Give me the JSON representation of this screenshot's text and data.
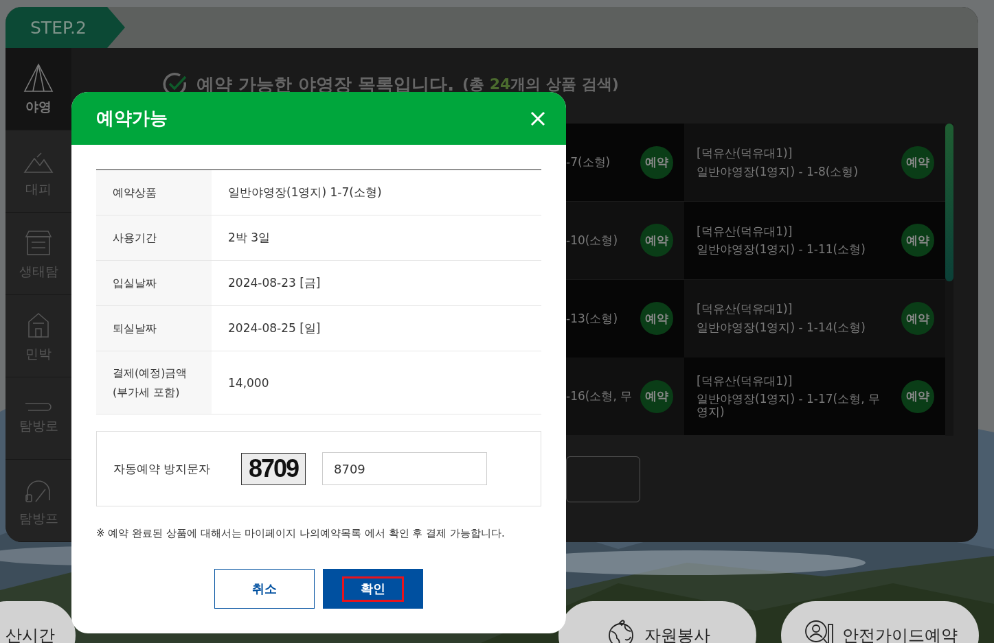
{
  "step": {
    "label": "STEP.2"
  },
  "sidebar": {
    "items": [
      {
        "label": "야영",
        "selected": true
      },
      {
        "label": "대피",
        "selected": false
      },
      {
        "label": "생태탐",
        "selected": false
      },
      {
        "label": "민박",
        "selected": false
      },
      {
        "label": "탐방로",
        "selected": false
      },
      {
        "label": "탐방프",
        "selected": false
      }
    ]
  },
  "heading": {
    "title": "예약 가능한 야영장 목록입니다.",
    "summary": {
      "before": "(총 ",
      "count": "24",
      "after": "개의 상품 검색)"
    }
  },
  "list": {
    "rows": [
      [
        {
          "name": "-7(소형)",
          "badge": "예약"
        },
        {
          "site": "[덕유산(덕유대1)]",
          "name": "일반야영장(1영지) - 1-8(소형)",
          "badge": "예약"
        }
      ],
      [
        {
          "name": "-10(소형)",
          "badge": "예약"
        },
        {
          "site": "[덕유산(덕유대1)]",
          "name": "일반야영장(1영지) - 1-11(소형)",
          "badge": "예약"
        }
      ],
      [
        {
          "name": "-13(소형)",
          "badge": "예약"
        },
        {
          "site": "[덕유산(덕유대1)]",
          "name": "일반야영장(1영지) - 1-14(소형)",
          "badge": "예약"
        }
      ],
      [
        {
          "name": "-16(소형, 무",
          "badge": "예약"
        },
        {
          "site": "[덕유산(덕유대1)]",
          "name": "일반야영장(1영지) - 1-17(소형, 무\n영지)",
          "badge": "예약"
        }
      ]
    ]
  },
  "bottom_links": [
    {
      "label": "산시간"
    },
    {
      "label": "자원봉사"
    },
    {
      "label": "안전가이드예약"
    }
  ],
  "dialog": {
    "title": "예약가능",
    "details": [
      {
        "label": "예약상품",
        "value": "일반야영장(1영지) 1-7(소형)"
      },
      {
        "label": "사용기간",
        "value": "2박 3일"
      },
      {
        "label": "입실날짜",
        "value": "2024-08-23 [금]"
      },
      {
        "label": "퇴실날짜",
        "value": "2024-08-25 [일]"
      },
      {
        "label": "결제(예정)금액\n(부가세 포함)",
        "value": "14,000"
      }
    ],
    "captcha": {
      "label": "자동예약 방지문자",
      "code": "8709",
      "value": "8709"
    },
    "note": "※ 예약 완료된 상품에 대해서는 마이페이지 나의예약목록 에서 확인 후 결제 가능합니다.",
    "buttons": [
      {
        "label": "취소",
        "kind": "secondary",
        "highlighted": false
      },
      {
        "label": "확인",
        "kind": "primary",
        "highlighted": true
      }
    ]
  }
}
